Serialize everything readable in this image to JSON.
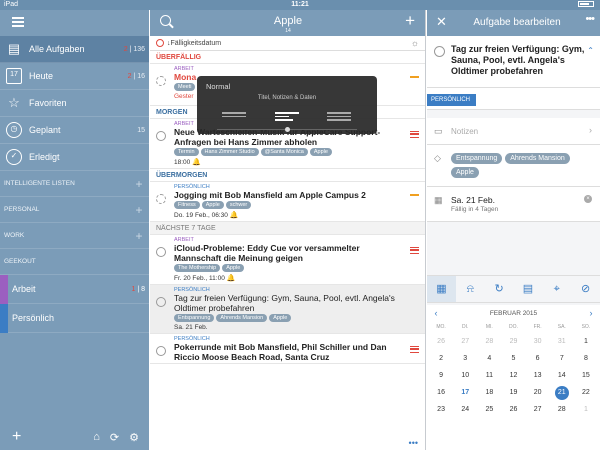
{
  "status": {
    "device": "iPad",
    "time": "11:21",
    "battery": ""
  },
  "sidebar": {
    "nav": [
      {
        "label": "Alle Aufgaben",
        "count_red": "2",
        "count": "136",
        "icon": "inbox-icon",
        "glyph": "▤"
      },
      {
        "label": "Heute",
        "count_red": "2",
        "count": "16",
        "icon": "calendar-icon",
        "glyph": "17"
      },
      {
        "label": "Favoriten",
        "count_red": "",
        "count": "",
        "icon": "star-icon",
        "glyph": "☆"
      },
      {
        "label": "Geplant",
        "count_red": "",
        "count": "15",
        "icon": "clock-icon",
        "glyph": "◷"
      },
      {
        "label": "Erledigt",
        "count_red": "",
        "count": "",
        "icon": "check-icon",
        "glyph": "✓"
      }
    ],
    "groups": [
      {
        "label": "INTELLIGENTE LISTEN"
      },
      {
        "label": "PERSONAL"
      },
      {
        "label": "WORK"
      },
      {
        "label": "GEEKOUT"
      }
    ],
    "lists": [
      {
        "label": "Arbeit",
        "count_red": "1",
        "count": "8",
        "color": "#9b5fc0"
      },
      {
        "label": "Persönlich",
        "count_red": "",
        "count": "",
        "color": "#3b7dc4"
      }
    ]
  },
  "middle": {
    "title": "Apple",
    "count": "14",
    "sort_label": "↓Fälligkeitsdatum",
    "sections": {
      "overdue": "ÜBERFÄLLIG",
      "tomorrow": "MORGEN",
      "dayafter": "ÜBERMORGEN",
      "next7": "NÄCHSTE 7 TAGE"
    },
    "tasks": [
      {
        "list": "ARBEIT",
        "title": "Mona",
        "tags": [
          "Meeti"
        ],
        "date": "Gester"
      },
      {
        "list": "ARBEIT",
        "title": "Neue Warteschleifen-Musik für AppleCare Support-Anfragen bei Hans Zimmer abholen",
        "tags": [
          "Termin",
          "Hans Zimmer Studio",
          "@Santa Monica",
          "Apple"
        ],
        "date": "18:00"
      },
      {
        "list": "PERSÖNLICH",
        "title": "Jogging mit Bob Mansfield am Apple Campus 2",
        "tags": [
          "Fitness",
          "Apple",
          "schwer"
        ],
        "date": "Do. 19 Feb., 06:30"
      },
      {
        "list": "ARBEIT",
        "title": "iCloud-Probleme: Eddy Cue vor versammelter Mannschaft die Meinung geigen",
        "tags": [
          "The Mothership",
          "Apple"
        ],
        "date": "Fr. 20 Feb., 11:00"
      },
      {
        "list": "PERSÖNLICH",
        "title": "Tag zur freien Verfügung: Gym, Sauna, Pool, evtl. Angela's Oldtimer probefahren",
        "tags": [
          "Entspannung",
          "Ahrends Mansion",
          "Apple"
        ],
        "date": "Sa. 21 Feb."
      },
      {
        "list": "PERSÖNLICH",
        "title": "Pokerrunde mit Bob Mansfield, Phil Schiller und Dan Riccio Moose Beach Road, Santa Cruz",
        "tags": [],
        "date": ""
      }
    ],
    "footer_more": "•••"
  },
  "popover": {
    "title": "Normal",
    "subtitle": "Titel, Notizen & Daten"
  },
  "detail": {
    "header_title": "Aufgabe bearbeiten",
    "task_title": "Tag zur freien Verfügung: Gym, Sauna, Pool, evtl. Angela's Oldtimer probefahren",
    "list_badge": "PERSÖNLICH",
    "notes_placeholder": "Notizen",
    "tags": [
      "Entspannung",
      "Ahrends Mansion",
      "Apple"
    ],
    "due_date": "Sa. 21 Feb.",
    "due_in": "Fällig in 4 Tagen"
  },
  "calendar": {
    "month": "FEBRUAR 2015",
    "weekdays": [
      "MO.",
      "DI.",
      "MI.",
      "DO.",
      "FR.",
      "SA.",
      "SO."
    ],
    "days": [
      "26",
      "27",
      "28",
      "29",
      "30",
      "31",
      "1",
      "2",
      "3",
      "4",
      "5",
      "6",
      "7",
      "8",
      "9",
      "10",
      "11",
      "12",
      "13",
      "14",
      "15",
      "16",
      "17",
      "18",
      "19",
      "20",
      "21",
      "22",
      "23",
      "24",
      "25",
      "26",
      "27",
      "28",
      "1"
    ],
    "today": "17",
    "selected": "21"
  }
}
